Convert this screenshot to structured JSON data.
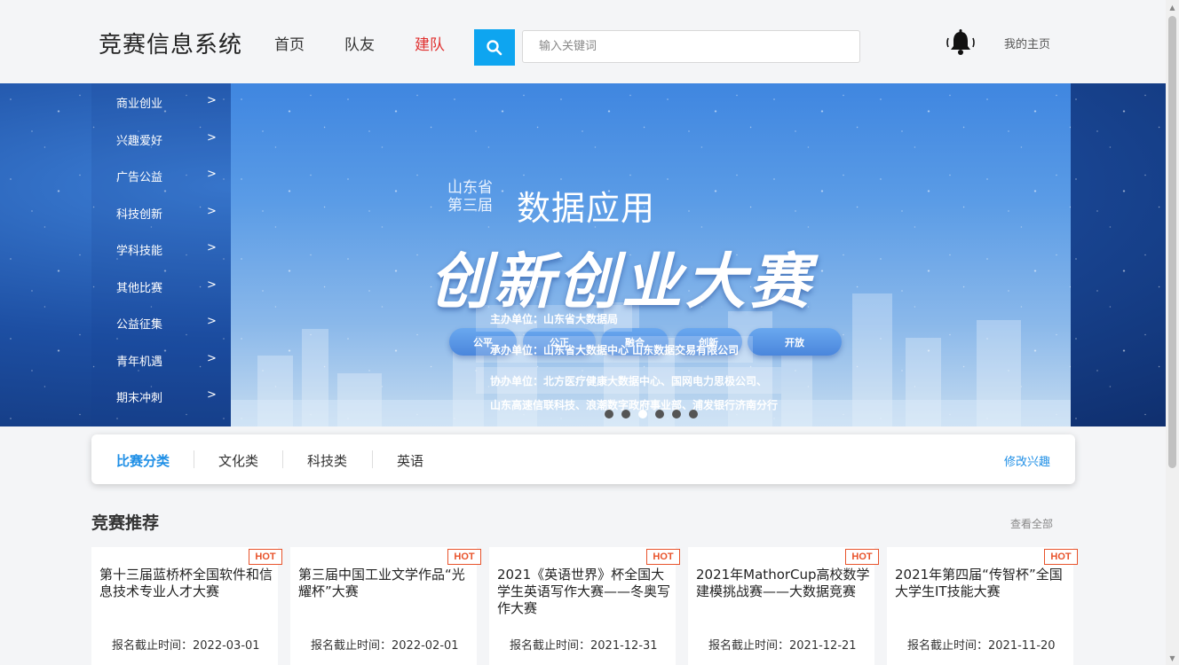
{
  "header": {
    "logo": "竞赛信息系统",
    "nav": [
      {
        "label": "首页",
        "active": false
      },
      {
        "label": "队友",
        "active": false
      },
      {
        "label": "建队",
        "active": true
      }
    ],
    "search": {
      "placeholder": "输入关键词",
      "value": "",
      "icon": "search-icon"
    },
    "bell_icon": "bell-icon",
    "my_home": "我的主页"
  },
  "banner": {
    "small_line1": "山东省",
    "small_line2": "第三届",
    "subtitle": "数据应用",
    "title": "创新创业大赛",
    "pills": [
      "公平",
      "公正",
      "融合",
      "创新",
      "开放"
    ],
    "info": [
      "主办单位：山东省大数据局",
      "承办单位：山东省大数据中心 山东数据交易有限公司",
      "协办单位：北方医疗健康大数据中心、国网电力思极公司、",
      "山东高速信联科技、浪潮数字政府事业部、浦发银行济南分行"
    ],
    "slides": 6,
    "active_slide": 3
  },
  "sidebar": {
    "items": [
      {
        "label": "商业创业",
        "arrow": ">"
      },
      {
        "label": "兴趣爱好",
        "arrow": ">"
      },
      {
        "label": "广告公益",
        "arrow": ">"
      },
      {
        "label": "科技创新",
        "arrow": ">"
      },
      {
        "label": "学科技能",
        "arrow": ">"
      },
      {
        "label": "其他比赛",
        "arrow": ">"
      },
      {
        "label": "公益征集",
        "arrow": ">"
      },
      {
        "label": "青年机遇",
        "arrow": ">"
      },
      {
        "label": "期末冲刺",
        "arrow": ">"
      }
    ]
  },
  "categories": {
    "items": [
      "比赛分类",
      "文化类",
      "科技类",
      "英语"
    ],
    "active": 0,
    "edit_label": "修改兴趣"
  },
  "recommend": {
    "title": "竞赛推荐",
    "view_all": "查看全部",
    "hot_label": "HOT",
    "cards": [
      {
        "name": "第十三届蓝桥杯全国软件和信息技术专业人才大赛",
        "deadline": "报名截止时间：2022-03-01"
      },
      {
        "name": "第三届中国工业文学作品“光耀杯”大赛",
        "deadline": "报名截止时间：2022-02-01"
      },
      {
        "name": "2021《英语世界》杯全国大学生英语写作大赛——冬奥写作大赛",
        "deadline": "报名截止时间：2021-12-31"
      },
      {
        "name": "2021年MathorCup高校数学建模挑战赛——大数据竞赛",
        "deadline": "报名截止时间：2021-12-21"
      },
      {
        "name": "2021年第四届“传智杯”全国大学生IT技能大赛",
        "deadline": "报名截止时间：2021-11-20"
      }
    ]
  },
  "colors": {
    "accent": "#0ea5f0",
    "nav_active": "#e0302f",
    "link_blue": "#1f8fe6",
    "hot": "#e8532b"
  }
}
